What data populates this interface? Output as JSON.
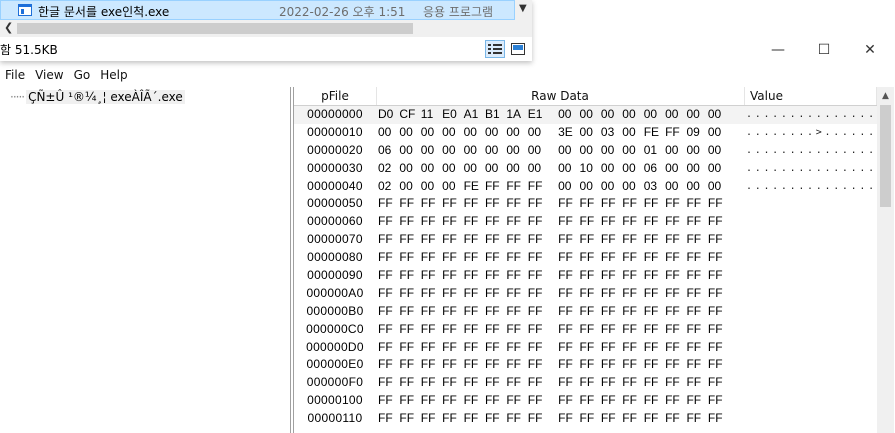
{
  "explorer": {
    "file": {
      "name": "한글 문서를 exe인척.exe",
      "date": "2022-02-26 오후 1:51",
      "type": "응용 프로그램"
    },
    "status": "함 51.5KB"
  },
  "viewer": {
    "window_controls": {
      "minimize": "—",
      "maximize": "☐",
      "close": "✕"
    },
    "menu": [
      "File",
      "View",
      "Go",
      "Help"
    ],
    "tree": {
      "label": "ÇÑ±Û ¹®¼­¸¦ exeÀÎÃ´.exe"
    },
    "columns": {
      "offset": "pFile",
      "raw": "Raw Data",
      "value": "Value"
    },
    "rows": [
      {
        "offset": "00000000",
        "bytes": [
          "D0",
          "CF",
          "11",
          "E0",
          "A1",
          "B1",
          "1A",
          "E1",
          "00",
          "00",
          "00",
          "00",
          "00",
          "00",
          "00",
          "00"
        ],
        "ascii": "................"
      },
      {
        "offset": "00000010",
        "bytes": [
          "00",
          "00",
          "00",
          "00",
          "00",
          "00",
          "00",
          "00",
          "3E",
          "00",
          "03",
          "00",
          "FE",
          "FF",
          "09",
          "00"
        ],
        "ascii": "........>......."
      },
      {
        "offset": "00000020",
        "bytes": [
          "06",
          "00",
          "00",
          "00",
          "00",
          "00",
          "00",
          "00",
          "00",
          "00",
          "00",
          "00",
          "01",
          "00",
          "00",
          "00"
        ],
        "ascii": "................"
      },
      {
        "offset": "00000030",
        "bytes": [
          "02",
          "00",
          "00",
          "00",
          "00",
          "00",
          "00",
          "00",
          "00",
          "10",
          "00",
          "00",
          "06",
          "00",
          "00",
          "00"
        ],
        "ascii": "................"
      },
      {
        "offset": "00000040",
        "bytes": [
          "02",
          "00",
          "00",
          "00",
          "FE",
          "FF",
          "FF",
          "FF",
          "00",
          "00",
          "00",
          "00",
          "03",
          "00",
          "00",
          "00"
        ],
        "ascii": "................"
      },
      {
        "offset": "00000050",
        "bytes": [
          "FF",
          "FF",
          "FF",
          "FF",
          "FF",
          "FF",
          "FF",
          "FF",
          "FF",
          "FF",
          "FF",
          "FF",
          "FF",
          "FF",
          "FF",
          "FF"
        ],
        "ascii": ""
      },
      {
        "offset": "00000060",
        "bytes": [
          "FF",
          "FF",
          "FF",
          "FF",
          "FF",
          "FF",
          "FF",
          "FF",
          "FF",
          "FF",
          "FF",
          "FF",
          "FF",
          "FF",
          "FF",
          "FF"
        ],
        "ascii": ""
      },
      {
        "offset": "00000070",
        "bytes": [
          "FF",
          "FF",
          "FF",
          "FF",
          "FF",
          "FF",
          "FF",
          "FF",
          "FF",
          "FF",
          "FF",
          "FF",
          "FF",
          "FF",
          "FF",
          "FF"
        ],
        "ascii": ""
      },
      {
        "offset": "00000080",
        "bytes": [
          "FF",
          "FF",
          "FF",
          "FF",
          "FF",
          "FF",
          "FF",
          "FF",
          "FF",
          "FF",
          "FF",
          "FF",
          "FF",
          "FF",
          "FF",
          "FF"
        ],
        "ascii": ""
      },
      {
        "offset": "00000090",
        "bytes": [
          "FF",
          "FF",
          "FF",
          "FF",
          "FF",
          "FF",
          "FF",
          "FF",
          "FF",
          "FF",
          "FF",
          "FF",
          "FF",
          "FF",
          "FF",
          "FF"
        ],
        "ascii": ""
      },
      {
        "offset": "000000A0",
        "bytes": [
          "FF",
          "FF",
          "FF",
          "FF",
          "FF",
          "FF",
          "FF",
          "FF",
          "FF",
          "FF",
          "FF",
          "FF",
          "FF",
          "FF",
          "FF",
          "FF"
        ],
        "ascii": ""
      },
      {
        "offset": "000000B0",
        "bytes": [
          "FF",
          "FF",
          "FF",
          "FF",
          "FF",
          "FF",
          "FF",
          "FF",
          "FF",
          "FF",
          "FF",
          "FF",
          "FF",
          "FF",
          "FF",
          "FF"
        ],
        "ascii": ""
      },
      {
        "offset": "000000C0",
        "bytes": [
          "FF",
          "FF",
          "FF",
          "FF",
          "FF",
          "FF",
          "FF",
          "FF",
          "FF",
          "FF",
          "FF",
          "FF",
          "FF",
          "FF",
          "FF",
          "FF"
        ],
        "ascii": ""
      },
      {
        "offset": "000000D0",
        "bytes": [
          "FF",
          "FF",
          "FF",
          "FF",
          "FF",
          "FF",
          "FF",
          "FF",
          "FF",
          "FF",
          "FF",
          "FF",
          "FF",
          "FF",
          "FF",
          "FF"
        ],
        "ascii": ""
      },
      {
        "offset": "000000E0",
        "bytes": [
          "FF",
          "FF",
          "FF",
          "FF",
          "FF",
          "FF",
          "FF",
          "FF",
          "FF",
          "FF",
          "FF",
          "FF",
          "FF",
          "FF",
          "FF",
          "FF"
        ],
        "ascii": ""
      },
      {
        "offset": "000000F0",
        "bytes": [
          "FF",
          "FF",
          "FF",
          "FF",
          "FF",
          "FF",
          "FF",
          "FF",
          "FF",
          "FF",
          "FF",
          "FF",
          "FF",
          "FF",
          "FF",
          "FF"
        ],
        "ascii": ""
      },
      {
        "offset": "00000100",
        "bytes": [
          "FF",
          "FF",
          "FF",
          "FF",
          "FF",
          "FF",
          "FF",
          "FF",
          "FF",
          "FF",
          "FF",
          "FF",
          "FF",
          "FF",
          "FF",
          "FF"
        ],
        "ascii": ""
      },
      {
        "offset": "00000110",
        "bytes": [
          "FF",
          "FF",
          "FF",
          "FF",
          "FF",
          "FF",
          "FF",
          "FF",
          "FF",
          "FF",
          "FF",
          "FF",
          "FF",
          "FF",
          "FF",
          "FF"
        ],
        "ascii": ""
      }
    ]
  },
  "colors": {
    "selection": "#cce8ff",
    "selection_border": "#99d1ff",
    "accent": "#1e6fd9"
  }
}
